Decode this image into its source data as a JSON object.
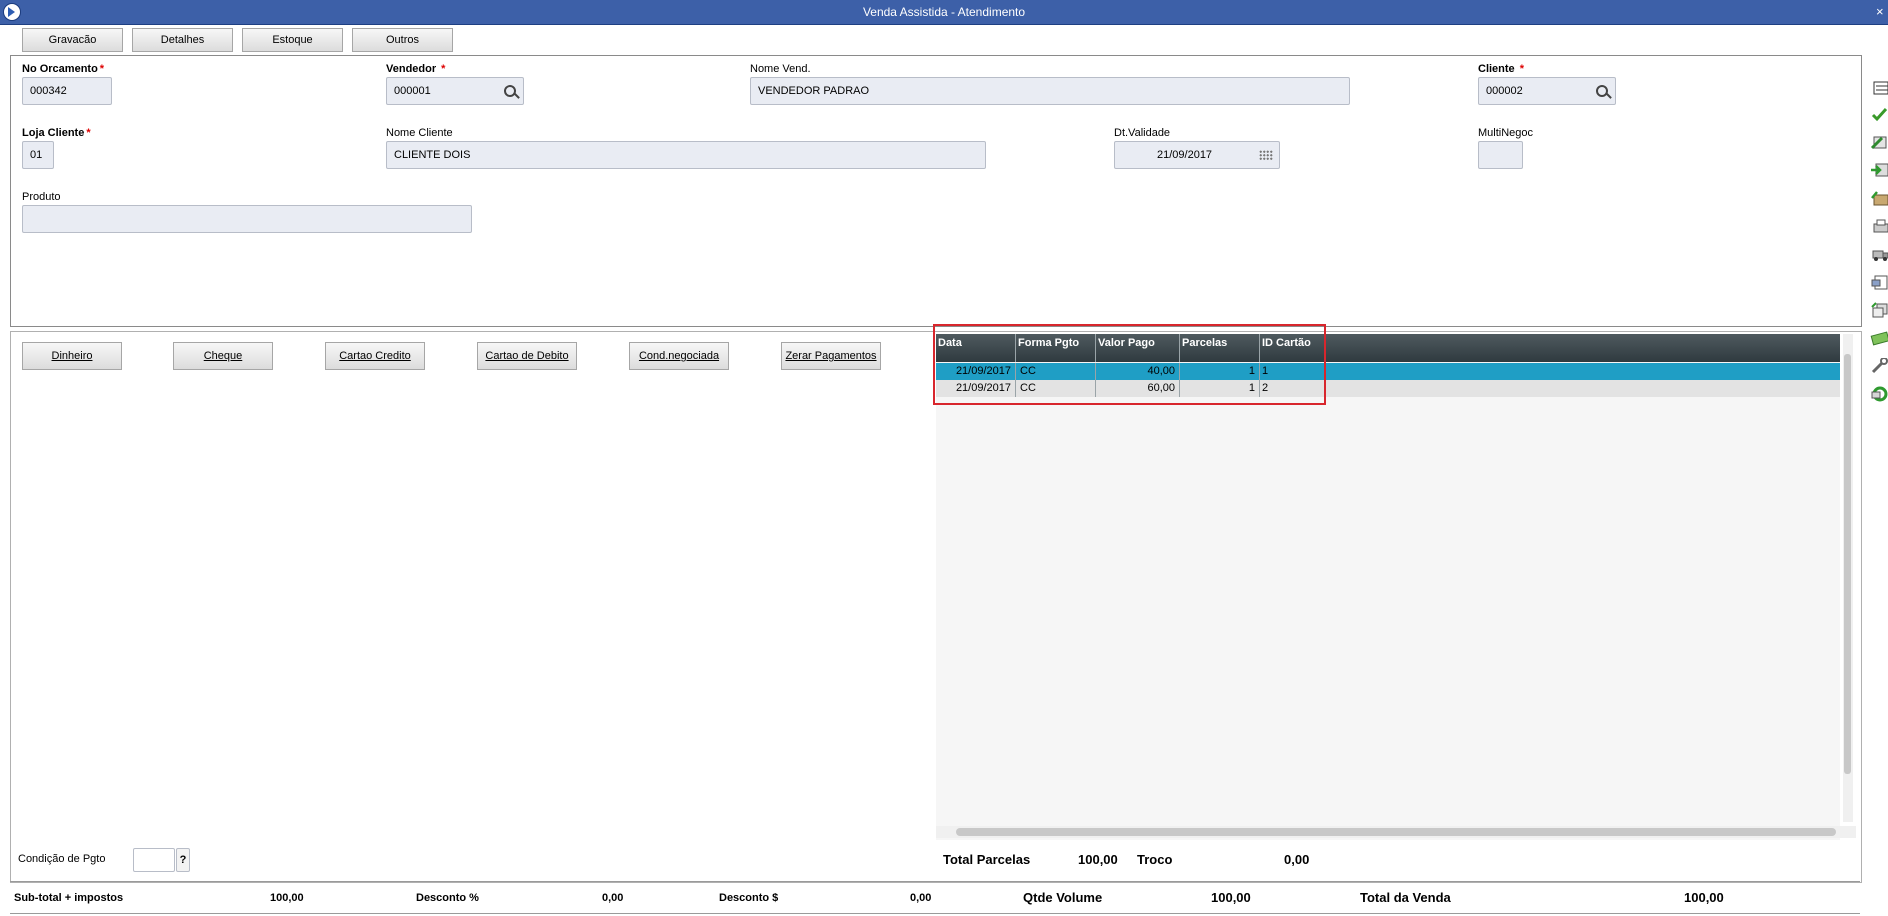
{
  "window": {
    "title": "Venda Assistida - Atendimento",
    "close_glyph": "×"
  },
  "toolbar": {
    "buttons": [
      "Gravacão",
      "Detalhes",
      "Estoque",
      "Outros"
    ]
  },
  "header": {
    "orcamento": {
      "label": "No Orcamento",
      "required": "*",
      "value": "000342"
    },
    "vendedor": {
      "label": "Vendedor",
      "required": "*",
      "value": "000001"
    },
    "nome_vend": {
      "label": "Nome Vend.",
      "value": "VENDEDOR PADRAO"
    },
    "cliente": {
      "label": "Cliente",
      "required": "*",
      "value": "000002"
    },
    "loja": {
      "label": "Loja Cliente",
      "required": "*",
      "value": "01"
    },
    "nome_cliente": {
      "label": "Nome Cliente",
      "value": "CLIENTE DOIS"
    },
    "validade": {
      "label": "Dt.Validade",
      "value": "21/09/2017"
    },
    "multinegoc": {
      "label": "MultiNegoc",
      "value": ""
    },
    "produto": {
      "label": "Produto",
      "value": ""
    }
  },
  "payment_buttons": [
    "Dinheiro",
    "Cheque",
    "Cartao Credito",
    "Cartao de Debito",
    "Cond.negociada",
    "Zerar Pagamentos"
  ],
  "payment_grid": {
    "columns": [
      "Data",
      "Forma Pgto",
      "Valor Pago",
      "Parcelas",
      "ID Cartão"
    ],
    "rows": [
      [
        "21/09/2017",
        "CC",
        "40,00",
        "1",
        "1"
      ],
      [
        "21/09/2017",
        "CC",
        "60,00",
        "1",
        "2"
      ]
    ],
    "selected_row_color": "#1f9ec5"
  },
  "condicao": {
    "label": "Condição de Pgto",
    "value": "",
    "help": "?"
  },
  "totals": {
    "total_parcelas_label": "Total Parcelas",
    "total_parcelas": "100,00",
    "troco_label": "Troco",
    "troco": "0,00"
  },
  "footer": {
    "subtotal_label": "Sub-total + impostos",
    "subtotal": "100,00",
    "desc_pct_label": "Desconto %",
    "desc_pct": "0,00",
    "desc_val_label": "Desconto $",
    "desc_val": "0,00",
    "qtde_label": "Qtde Volume",
    "qtde": "100,00",
    "total_label": "Total da Venda",
    "total": "100,00"
  },
  "sidebar_icons": [
    "menu-icon",
    "check-icon",
    "edit-icon",
    "green-arrow-icon",
    "package-icon",
    "printer-icon",
    "truck-icon",
    "document-icon",
    "copy-icon",
    "money-icon",
    "tools-icon",
    "refresh-icon"
  ]
}
